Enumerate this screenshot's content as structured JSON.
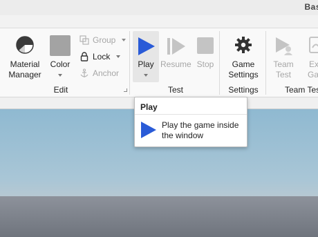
{
  "window": {
    "title": "Bas"
  },
  "ribbon": {
    "edit_group": {
      "label": "Edit",
      "material_manager": {
        "label_line1": "Material",
        "label_line2": "Manager",
        "icon": "material-sphere-icon"
      },
      "color": {
        "label": "Color",
        "swatch": "#a3a3a3"
      },
      "group": {
        "label": "Group"
      },
      "lock": {
        "label": "Lock"
      },
      "anchor": {
        "label": "Anchor"
      }
    },
    "test_group": {
      "label": "Test",
      "play": {
        "label": "Play"
      },
      "resume": {
        "label": "Resume"
      },
      "stop": {
        "label": "Stop"
      }
    },
    "settings_group": {
      "label": "Settings",
      "game_settings": {
        "label_line1": "Game",
        "label_line2": "Settings",
        "icon": "gear-icon"
      }
    },
    "team_test_group": {
      "label": "Team Test",
      "team_test": {
        "label_line1": "Team",
        "label_line2": "Test"
      },
      "exit_game": {
        "label_line1": "Ex",
        "label_line2": "Ga"
      }
    }
  },
  "tooltip": {
    "title": "Play",
    "description": "Play the game inside the window"
  },
  "colors": {
    "play_blue": "#2a5bd7",
    "disabled_gray": "#c4c4c4",
    "sky_top": "#8fb9d1",
    "ground": "#7e838d"
  }
}
